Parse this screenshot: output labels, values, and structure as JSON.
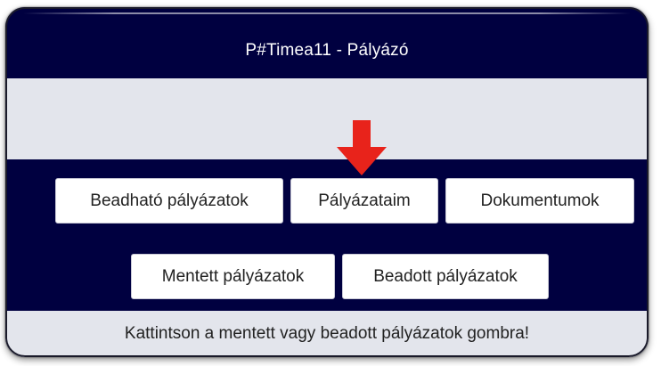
{
  "header": {
    "title": "P#Timea11 - Pályázó"
  },
  "nav": {
    "buttons": [
      {
        "label": "Beadható pályázatok"
      },
      {
        "label": "Pályázataim"
      },
      {
        "label": "Dokumentumok"
      },
      {
        "label": "Mentett pályázatok"
      },
      {
        "label": "Beadott pályázatok"
      }
    ]
  },
  "annotation": {
    "arrow_icon": "down-arrow-icon",
    "arrow_color": "#e8231b"
  },
  "footer": {
    "message": "Kattintson a mentett vagy beadott pályázatok gombra!"
  },
  "colors": {
    "header_bg": "#000040",
    "band_bg": "#e3e5ec",
    "button_bg": "#ffffff"
  }
}
